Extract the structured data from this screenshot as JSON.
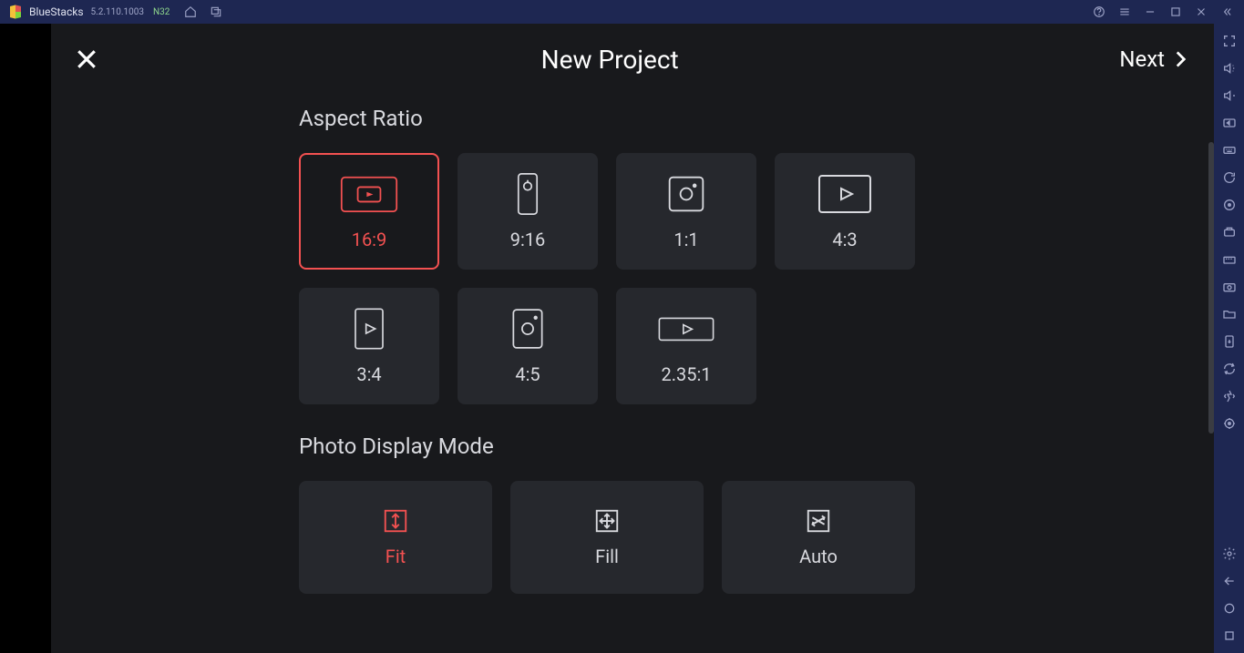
{
  "titlebar": {
    "appName": "BlueStacks",
    "version": "5.2.110.1003",
    "arch": "N32"
  },
  "app": {
    "title": "New Project",
    "next": "Next"
  },
  "sections": {
    "aspectRatio": "Aspect Ratio",
    "photoDisplayMode": "Photo Display Mode"
  },
  "ratios": [
    {
      "label": "16:9",
      "icon": "youtube",
      "selected": true
    },
    {
      "label": "9:16",
      "icon": "phone-portrait",
      "selected": false
    },
    {
      "label": "1:1",
      "icon": "instagram-square",
      "selected": false
    },
    {
      "label": "4:3",
      "icon": "play-landscape",
      "selected": false
    },
    {
      "label": "3:4",
      "icon": "play-portrait",
      "selected": false
    },
    {
      "label": "4:5",
      "icon": "instagram-portrait",
      "selected": false
    },
    {
      "label": "2.35:1",
      "icon": "play-cinema",
      "selected": false
    }
  ],
  "modes": [
    {
      "label": "Fit",
      "icon": "fit",
      "selected": true
    },
    {
      "label": "Fill",
      "icon": "fill",
      "selected": false
    },
    {
      "label": "Auto",
      "icon": "auto",
      "selected": false
    }
  ]
}
